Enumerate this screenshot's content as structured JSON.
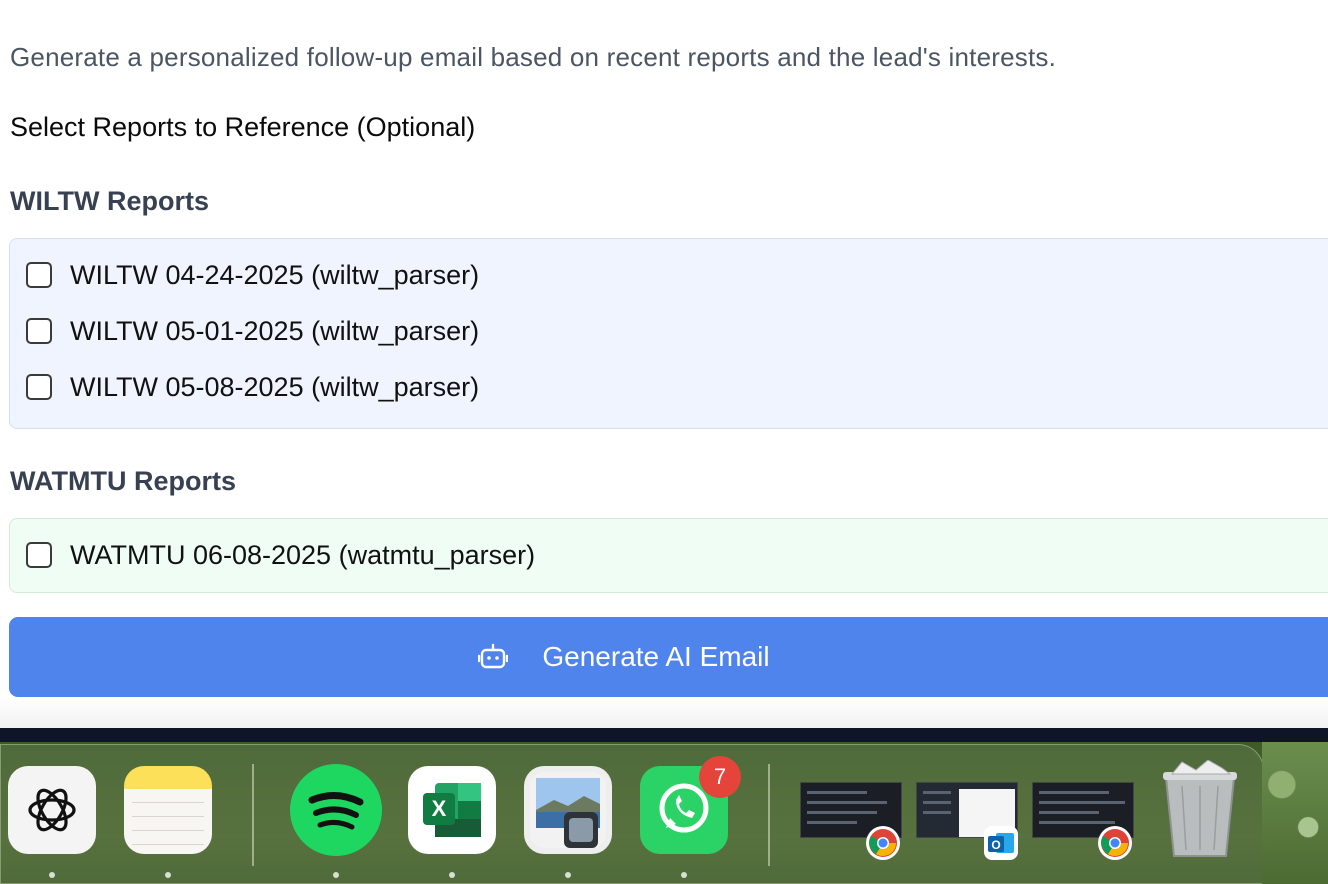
{
  "description": "Generate a personalized follow-up email based on recent reports and the lead's interests.",
  "select_title": "Select Reports to Reference (Optional)",
  "wiltw": {
    "title": "WILTW Reports",
    "items": [
      {
        "label": "WILTW 04-24-2025 (wiltw_parser)",
        "checked": false
      },
      {
        "label": "WILTW 05-01-2025 (wiltw_parser)",
        "checked": false
      },
      {
        "label": "WILTW 05-08-2025 (wiltw_parser)",
        "checked": false
      }
    ]
  },
  "watmtu": {
    "title": "WATMTU Reports",
    "items": [
      {
        "label": "WATMTU 06-08-2025 (watmtu_parser)",
        "checked": false
      }
    ]
  },
  "generate_button": {
    "label": "Generate AI Email",
    "icon": "robot-icon"
  },
  "colors": {
    "accent": "#4f84ed",
    "wiltw_box_bg": "#eff4ff",
    "watmtu_box_bg": "#f0fdf4",
    "whatsapp_badge": "#e5443a"
  },
  "dock": {
    "apps": [
      "ChatGPT",
      "Notes",
      "Spotify",
      "Microsoft Excel",
      "Preview",
      "WhatsApp"
    ],
    "whatsapp_badge": "7",
    "recent_windows": [
      "Google Chrome",
      "Microsoft Outlook",
      "Google Chrome"
    ],
    "trash": "Trash",
    "excel_letter": "X",
    "outlook_letter": "O"
  }
}
